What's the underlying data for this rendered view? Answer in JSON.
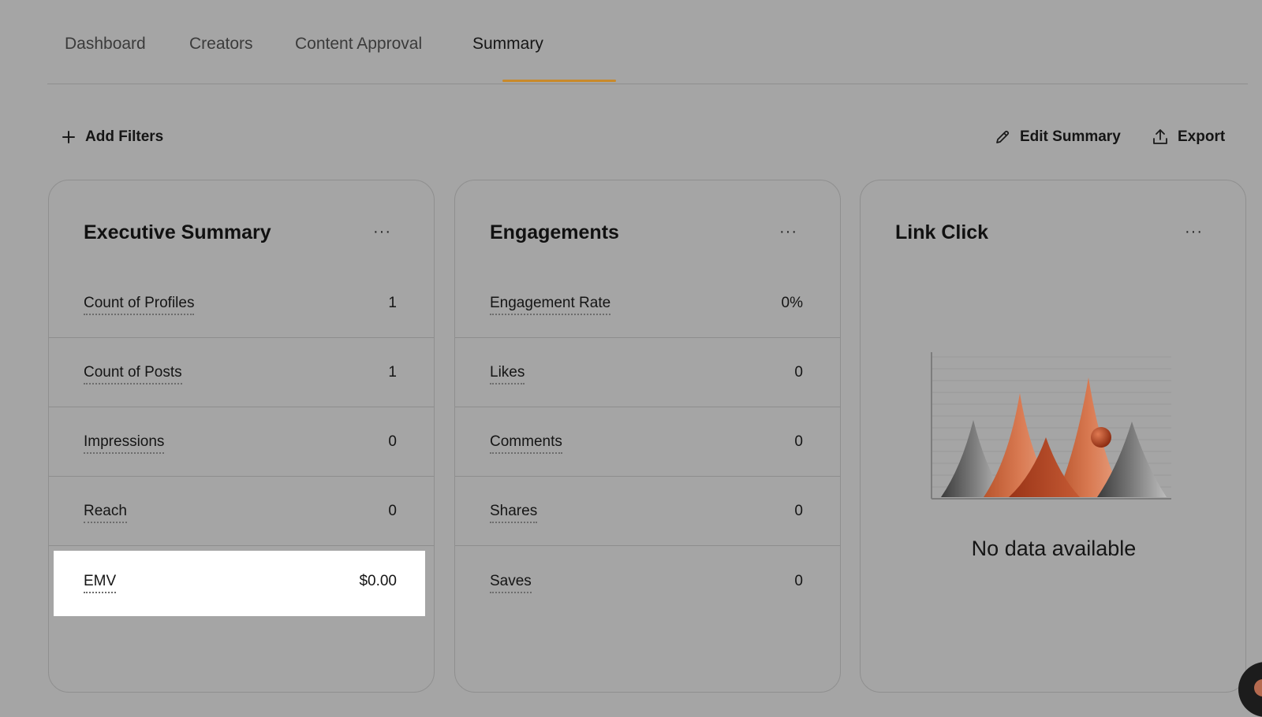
{
  "tabs": [
    "Dashboard",
    "Creators",
    "Content Approval",
    "Summary"
  ],
  "active_tab": "Summary",
  "toolbar": {
    "add_filters": "Add Filters",
    "edit_summary": "Edit Summary",
    "export": "Export"
  },
  "cards": {
    "executive": {
      "title": "Executive Summary",
      "menu": "···",
      "rows": [
        {
          "label": "Count of Profiles",
          "value": "1"
        },
        {
          "label": "Count of Posts",
          "value": "1"
        },
        {
          "label": "Impressions",
          "value": "0"
        },
        {
          "label": "Reach",
          "value": "0"
        },
        {
          "label": "EMV",
          "value": "$0.00"
        }
      ]
    },
    "engagements": {
      "title": "Engagements",
      "menu": "···",
      "rows": [
        {
          "label": "Engagement Rate",
          "value": "0%"
        },
        {
          "label": "Likes",
          "value": "0"
        },
        {
          "label": "Comments",
          "value": "0"
        },
        {
          "label": "Shares",
          "value": "0"
        },
        {
          "label": "Saves",
          "value": "0"
        }
      ]
    },
    "link_click": {
      "title": "Link Click",
      "menu": "···",
      "empty_text": "No data available"
    }
  },
  "colors": {
    "accent_underline": "#c98a2b",
    "background": "#a5a5a5",
    "highlight": "#ffffff"
  }
}
